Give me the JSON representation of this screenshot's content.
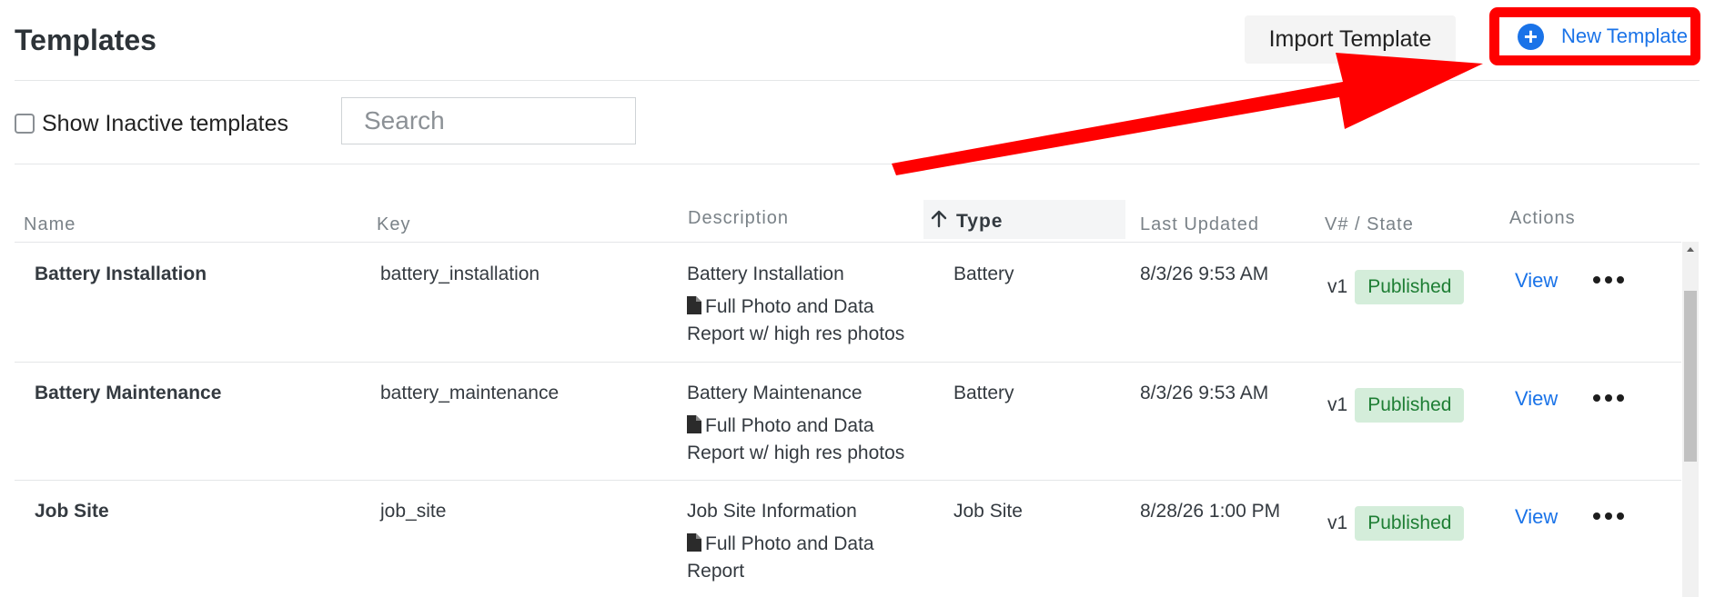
{
  "header": {
    "title": "Templates",
    "import_label": "Import Template",
    "new_label": "New Template"
  },
  "filters": {
    "show_inactive_label": "Show Inactive templates",
    "show_inactive_checked": false,
    "search_placeholder": "Search",
    "search_value": ""
  },
  "table": {
    "columns": {
      "name": "Name",
      "key": "Key",
      "description": "Description",
      "type": "Type",
      "last_updated": "Last Updated",
      "version_state": "V# / State",
      "actions": "Actions"
    },
    "sort": {
      "column": "Type",
      "direction": "ascending"
    },
    "rows": [
      {
        "name": "Battery Installation",
        "key": "battery_installation",
        "description": "Battery Installation",
        "report_line1": "Full Photo and Data",
        "report_line2": "Report w/ high res photos",
        "type": "Battery",
        "last_updated": "8/3/26 9:53 AM",
        "version": "v1",
        "state": "Published",
        "action": "View"
      },
      {
        "name": "Battery Maintenance",
        "key": "battery_maintenance",
        "description": "Battery Maintenance",
        "report_line1": "Full Photo and Data",
        "report_line2": "Report w/ high res photos",
        "type": "Battery",
        "last_updated": "8/3/26 9:53 AM",
        "version": "v1",
        "state": "Published",
        "action": "View"
      },
      {
        "name": "Job Site",
        "key": "job_site",
        "description": "Job Site Information",
        "report_line1": "Full Photo and Data",
        "report_line2": "Report",
        "type": "Job Site",
        "last_updated": "8/28/26 1:00 PM",
        "version": "v1",
        "state": "Published",
        "action": "View"
      }
    ]
  },
  "icons": {
    "new_template": "plus-circle-icon",
    "sort": "arrow-up-icon",
    "report": "document-icon",
    "row_menu": "more-horizontal-icon"
  },
  "colors": {
    "accent": "#1a73e8",
    "published_bg": "#d4edda",
    "published_text": "#1e7e34",
    "annotation": "#ff0000"
  }
}
